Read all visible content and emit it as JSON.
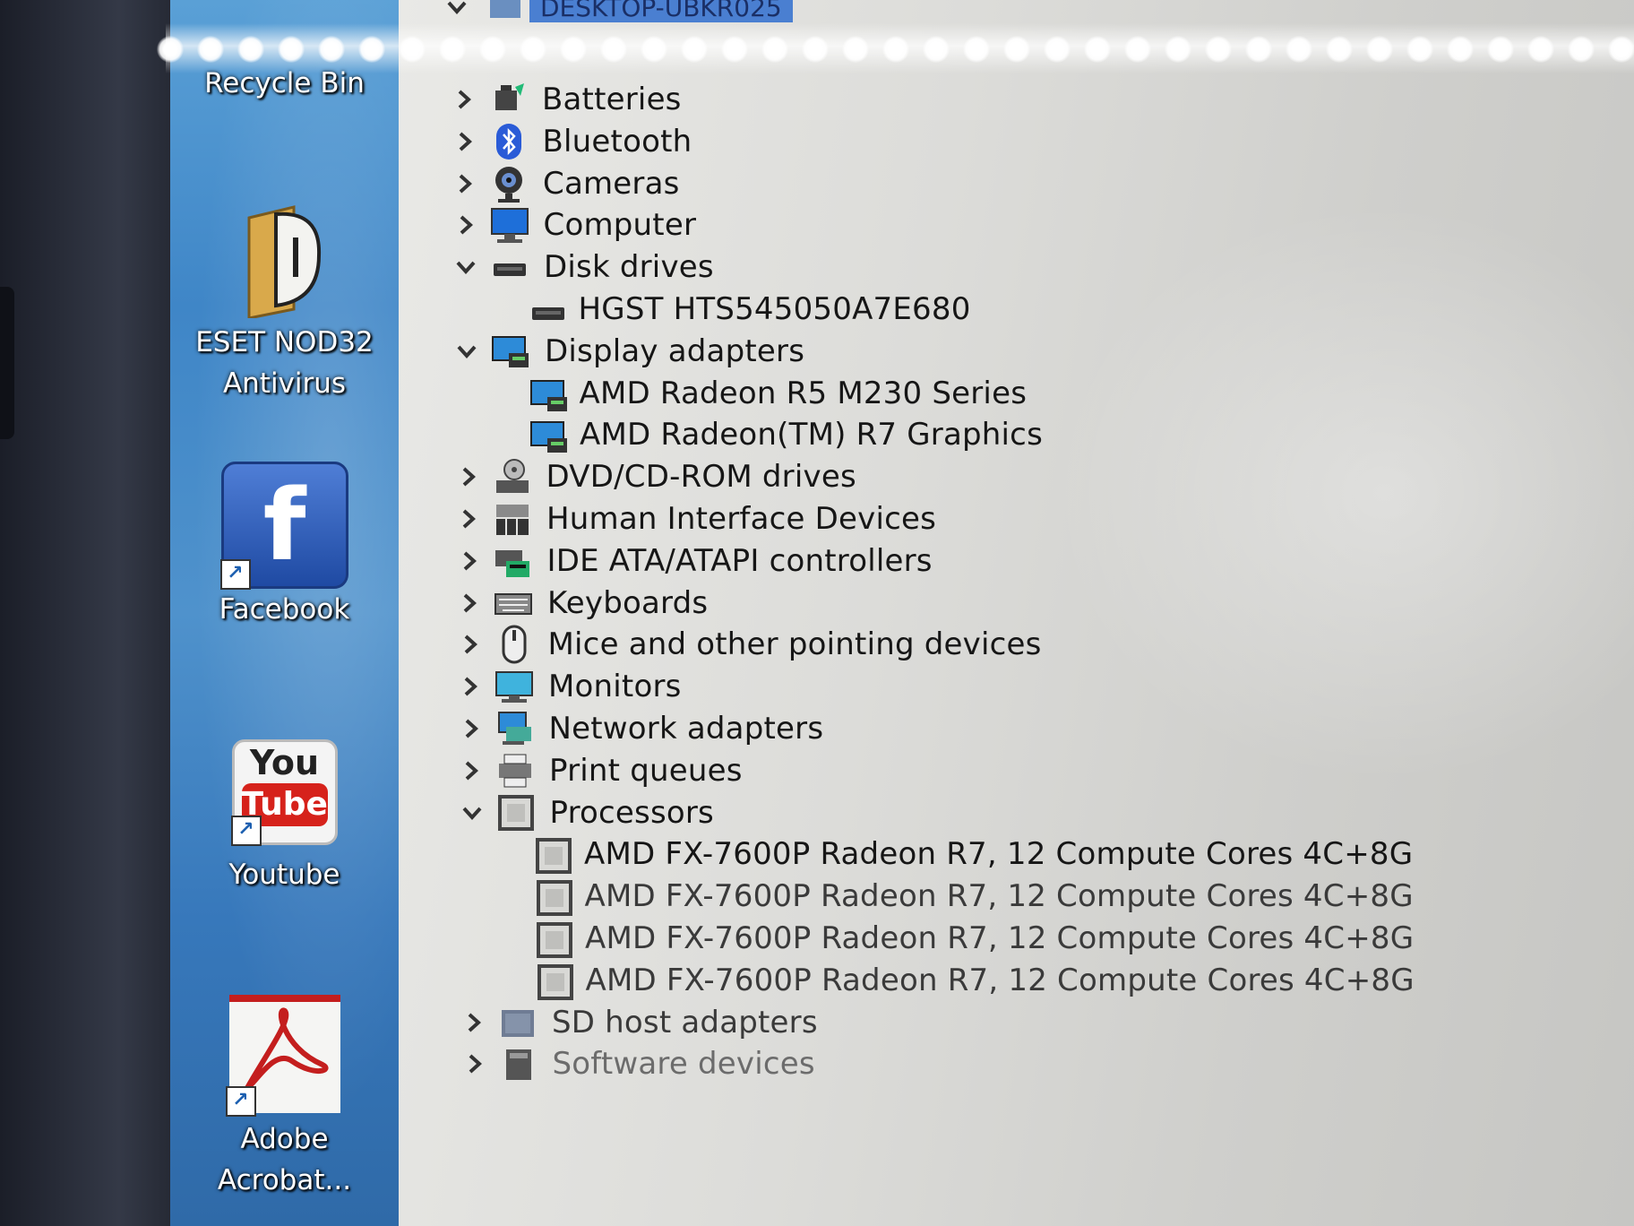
{
  "desktop": {
    "icons": [
      {
        "label": "Recycle Bin"
      },
      {
        "label": "ESET NOD32 Antivirus"
      },
      {
        "label": "Facebook"
      },
      {
        "label": "Youtube"
      },
      {
        "label": "Adobe Acrobat..."
      }
    ],
    "facebook_glyph": "f",
    "youtube_glyph_top": "You",
    "youtube_glyph_bottom": "Tube"
  },
  "device_manager": {
    "root": "DESKTOP-UBKR025",
    "categories": [
      {
        "label": "Batteries",
        "expanded": false,
        "icon": "battery-icon"
      },
      {
        "label": "Bluetooth",
        "expanded": false,
        "icon": "bluetooth-icon"
      },
      {
        "label": "Cameras",
        "expanded": false,
        "icon": "camera-icon"
      },
      {
        "label": "Computer",
        "expanded": false,
        "icon": "computer-icon"
      },
      {
        "label": "Disk drives",
        "expanded": true,
        "icon": "disk-drive-icon",
        "children": [
          "HGST HTS545050A7E680"
        ]
      },
      {
        "label": "Display adapters",
        "expanded": true,
        "icon": "display-adapter-icon",
        "children": [
          "AMD Radeon R5 M230 Series",
          "AMD Radeon(TM) R7 Graphics"
        ]
      },
      {
        "label": "DVD/CD-ROM drives",
        "expanded": false,
        "icon": "dvd-drive-icon"
      },
      {
        "label": "Human Interface Devices",
        "expanded": false,
        "icon": "hid-icon"
      },
      {
        "label": "IDE ATA/ATAPI controllers",
        "expanded": false,
        "icon": "ide-controller-icon"
      },
      {
        "label": "Keyboards",
        "expanded": false,
        "icon": "keyboard-icon"
      },
      {
        "label": "Mice and other pointing devices",
        "expanded": false,
        "icon": "mouse-icon"
      },
      {
        "label": "Monitors",
        "expanded": false,
        "icon": "monitor-icon"
      },
      {
        "label": "Network adapters",
        "expanded": false,
        "icon": "network-adapter-icon"
      },
      {
        "label": "Print queues",
        "expanded": false,
        "icon": "printer-icon"
      },
      {
        "label": "Processors",
        "expanded": true,
        "icon": "processor-icon",
        "children": [
          "AMD FX-7600P Radeon R7, 12 Compute Cores 4C+8G",
          "AMD FX-7600P Radeon R7, 12 Compute Cores 4C+8G",
          "AMD FX-7600P Radeon R7, 12 Compute Cores 4C+8G",
          "AMD FX-7600P Radeon R7, 12 Compute Cores 4C+8G"
        ]
      },
      {
        "label": "SD host adapters",
        "expanded": false,
        "icon": "sd-adapter-icon"
      },
      {
        "label": "Software devices",
        "expanded": false,
        "icon": "software-device-icon"
      }
    ]
  }
}
